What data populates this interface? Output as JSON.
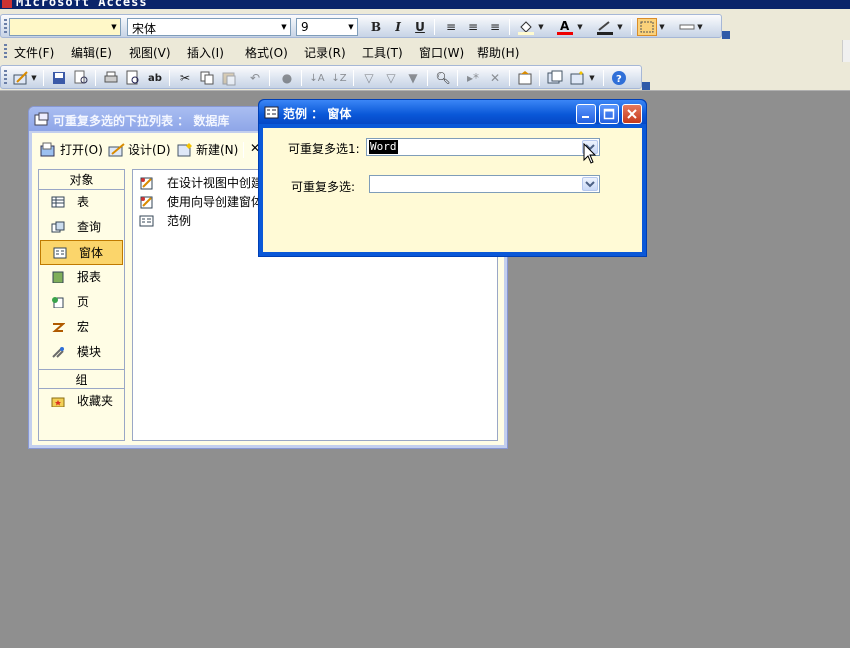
{
  "app": {
    "title": "Microsoft Access"
  },
  "format_bar": {
    "object_combo": "",
    "font_name": "宋体",
    "font_size": "9"
  },
  "menu": [
    "文件(F)",
    "编辑(E)",
    "视图(V)",
    "插入(I)",
    "格式(O)",
    "记录(R)",
    "工具(T)",
    "窗口(W)",
    "帮助(H)"
  ],
  "db_window": {
    "title": "可重复多选的下拉列表 ： 数据库",
    "toolbar": {
      "open": "打开(O)",
      "design": "设计(D)",
      "new": "新建(N)"
    },
    "objects_header": "对象",
    "objects": [
      {
        "label": "表",
        "icon": "table-icon"
      },
      {
        "label": "查询",
        "icon": "query-icon"
      },
      {
        "label": "窗体",
        "icon": "form-icon",
        "selected": true
      },
      {
        "label": "报表",
        "icon": "report-icon"
      },
      {
        "label": "页",
        "icon": "page-icon"
      },
      {
        "label": "宏",
        "icon": "macro-icon"
      },
      {
        "label": "模块",
        "icon": "module-icon"
      }
    ],
    "groups_header": "组",
    "groups": [
      {
        "label": "收藏夹",
        "icon": "favorites-icon"
      }
    ],
    "items": [
      {
        "label": "在设计视图中创建窗体",
        "icon": "wizard-icon"
      },
      {
        "label": "使用向导创建窗体",
        "icon": "wizard-icon"
      },
      {
        "label": "范例",
        "icon": "form-icon"
      }
    ]
  },
  "form_window": {
    "title": "范例 ： 窗体",
    "field1": {
      "label": "可重复多选1:",
      "value": "Word"
    },
    "field2": {
      "label": "可重复多选:",
      "value": ""
    }
  },
  "colors": {
    "xp_blue": "#0a58d8",
    "form_back": "#fffad6",
    "selected_object": "#fbd56b",
    "workspace": "#8f8f8f"
  }
}
